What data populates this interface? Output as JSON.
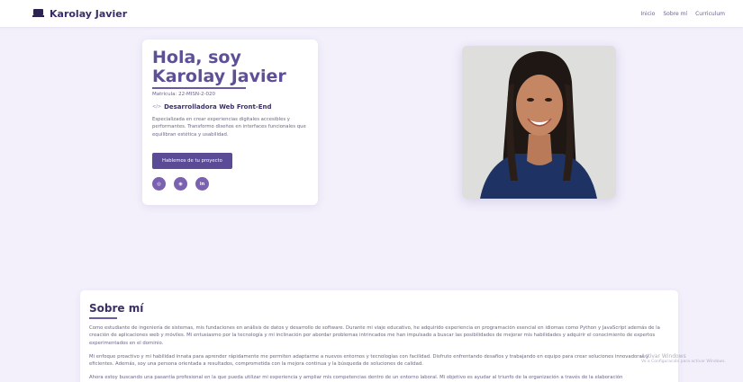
{
  "nav": {
    "brand": "Karolay Javier",
    "brand_icon": "laptop-icon",
    "links": [
      "Inicio",
      "Sobre mí",
      "Curriculum"
    ]
  },
  "hero": {
    "title": "Hola, soy Karolay Javier",
    "matricula": "Matrícula: 22-MISN-2-020",
    "role_icon": "code-icon",
    "role": "Desarrolladora Web Front-End",
    "description": "Especializada en crear experiencias digitales accesibles y performantes. Transformo diseños en interfaces funcionales que equilibran estética y usabilidad.",
    "cta": "Hablemos de tu proyecto",
    "socials": [
      {
        "icon": "instagram-icon",
        "glyph": "◎"
      },
      {
        "icon": "github-icon",
        "glyph": "◉"
      },
      {
        "icon": "linkedin-icon",
        "glyph": "in"
      }
    ]
  },
  "about": {
    "title": "Sobre mí",
    "paragraphs": [
      "Como estudiante de ingeniería de sistemas, mis fundaciones en análisis de datos y desarrollo de software. Durante mi viaje educativo, he adquirido experiencia en programación esencial en idiomas como Python y JavaScript además de la creación de aplicaciones web y móviles. Mi entusiasmo por la tecnología y mi inclinación por abordar problemas intrincados me han impulsado a buscar las posibilidades de mejorar mis habilidades y adquirir el conocimiento de expertos experimentados en el dominio.",
      "Mi enfoque proactivo y mi habilidad innata para aprender rápidamente me permiten adaptarme a nuevos entornos y tecnologías con facilidad. Disfruto enfrentando desafíos y trabajando en equipo para crear soluciones innovadoras y eficientes. Además, soy una persona orientada a resultados, comprometida con la mejora continua y la búsqueda de soluciones de calidad.",
      "Ahora estoy buscando una pasantía profesional en la que pueda utilizar mi experiencia y ampliar mis competencias dentro de un entorno laboral. Mi objetivo es ayudar al triunfo de la organización a través de la elaboración"
    ]
  },
  "watermark": {
    "title": "Activar Windows",
    "subtitle": "Ve a Configuración para activar Windows."
  },
  "colors": {
    "accent": "#5b4a96",
    "title": "#5e4f97",
    "background": "#f3f0fb"
  }
}
